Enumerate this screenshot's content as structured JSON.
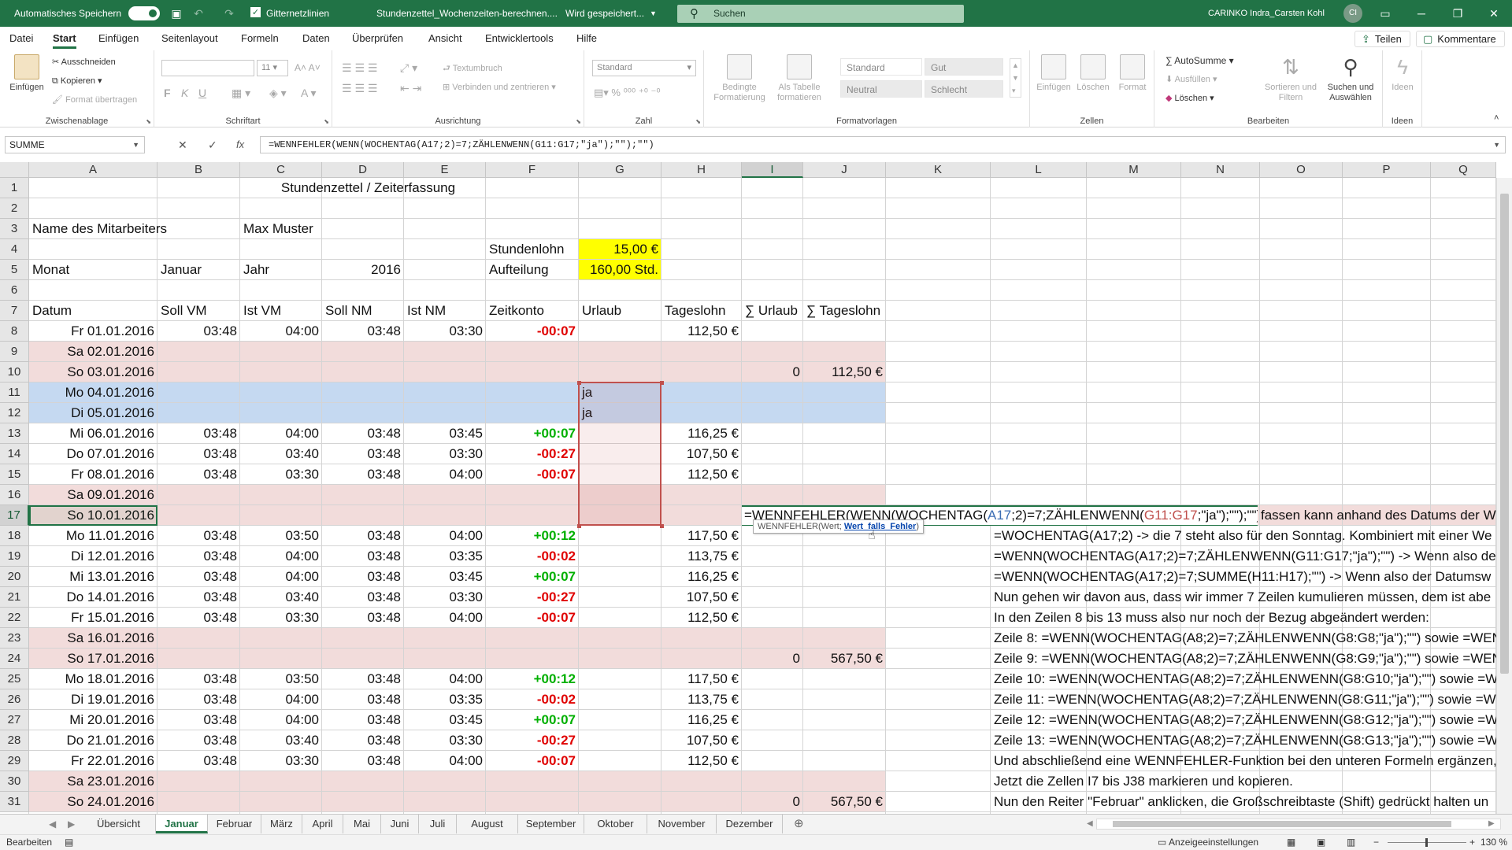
{
  "titlebar": {
    "autosave_label": "Automatisches Speichern",
    "gridlines_label": "Gitternetzlinien",
    "doc_title": "Stundenzettel_Wochenzeiten-berechnen....",
    "saving_status": "Wird gespeichert...",
    "search_placeholder": "Suchen",
    "user_name": "CARINKO Indra_Carsten Kohl",
    "user_initials": "CI"
  },
  "ribbon_tabs": [
    "Datei",
    "Start",
    "Einfügen",
    "Seitenlayout",
    "Formeln",
    "Daten",
    "Überprüfen",
    "Ansicht",
    "Entwicklertools",
    "Hilfe"
  ],
  "header_buttons": {
    "share": "Teilen",
    "comments": "Kommentare"
  },
  "ribbon": {
    "clipboard": {
      "paste": "Einfügen",
      "cut": "Ausschneiden",
      "copy": "Kopieren",
      "format_painter": "Format übertragen",
      "label": "Zwischenablage"
    },
    "font": {
      "label": "Schriftart",
      "size": "11",
      "bold": "F",
      "italic": "K",
      "underline": "U"
    },
    "alignment": {
      "wrap": "Textumbruch",
      "merge": "Verbinden und zentrieren",
      "label": "Ausrichtung"
    },
    "number": {
      "format": "Standard",
      "label": "Zahl"
    },
    "styles": {
      "cond_format": "Bedingte Formatierung",
      "as_table": "Als Tabelle formatieren",
      "standard": "Standard",
      "gut": "Gut",
      "neutral": "Neutral",
      "schlecht": "Schlecht",
      "label": "Formatvorlagen"
    },
    "cells": {
      "insert": "Einfügen",
      "delete": "Löschen",
      "format": "Format",
      "label": "Zellen"
    },
    "editing": {
      "autosum": "AutoSumme",
      "fill": "Ausfüllen",
      "clear": "Löschen",
      "sort": "Sortieren und Filtern",
      "find": "Suchen und Auswählen",
      "label": "Bearbeiten"
    },
    "ideas": {
      "ideas": "Ideen",
      "label": "Ideen"
    }
  },
  "formula_bar": {
    "name_box": "SUMME",
    "formula": "=WENNFEHLER(WENN(WOCHENTAG(A17;2)=7;ZÄHLENWENN(G11:G17;\"ja\");\"\");\"\")"
  },
  "columns": [
    "A",
    "B",
    "C",
    "D",
    "E",
    "F",
    "G",
    "H",
    "I",
    "J",
    "K",
    "L",
    "M",
    "N",
    "O",
    "P",
    "Q"
  ],
  "rows": [
    "1",
    "2",
    "3",
    "4",
    "5",
    "6",
    "7",
    "8",
    "9",
    "10",
    "11",
    "12",
    "13",
    "14",
    "15",
    "16",
    "17",
    "18",
    "19",
    "20",
    "21",
    "22",
    "23",
    "24",
    "25",
    "26",
    "27",
    "28",
    "29",
    "30",
    "31"
  ],
  "sheet": {
    "title": "Stundenzettel / Zeiterfassung",
    "employee_label": "Name des Mitarbeiters",
    "employee_name": "Max Muster",
    "wage_label": "Stundenlohn",
    "wage_value": "15,00 €",
    "month_label": "Monat",
    "month_value": "Januar",
    "year_label": "Jahr",
    "year_value": "2016",
    "split_label": "Aufteilung",
    "split_value": "160,00 Std.",
    "headers": {
      "datum": "Datum",
      "soll_vm": "Soll VM",
      "ist_vm": "Ist VM",
      "soll_nm": "Soll NM",
      "ist_nm": "Ist NM",
      "zeitkonto": "Zeitkonto",
      "urlaub": "Urlaub",
      "tageslohn": "Tageslohn",
      "sum_urlaub": "∑ Urlaub",
      "sum_tageslohn": "∑ Tageslohn"
    },
    "days": [
      {
        "datum": "Fr 01.01.2016",
        "soll_vm": "03:48",
        "ist_vm": "04:00",
        "soll_nm": "03:48",
        "ist_nm": "03:30",
        "zeitkonto": "-00:07",
        "urlaub": "",
        "tageslohn": "112,50 €",
        "sum_urlaub": "",
        "sum_tageslohn": ""
      },
      {
        "datum": "Sa 02.01.2016",
        "soll_vm": "",
        "ist_vm": "",
        "soll_nm": "",
        "ist_nm": "",
        "zeitkonto": "",
        "urlaub": "",
        "tageslohn": "",
        "sum_urlaub": "",
        "sum_tageslohn": ""
      },
      {
        "datum": "So 03.01.2016",
        "soll_vm": "",
        "ist_vm": "",
        "soll_nm": "",
        "ist_nm": "",
        "zeitkonto": "",
        "urlaub": "",
        "tageslohn": "",
        "sum_urlaub": "0",
        "sum_tageslohn": "112,50 €"
      },
      {
        "datum": "Mo 04.01.2016",
        "soll_vm": "",
        "ist_vm": "",
        "soll_nm": "",
        "ist_nm": "",
        "zeitkonto": "",
        "urlaub": "ja",
        "tageslohn": "",
        "sum_urlaub": "",
        "sum_tageslohn": ""
      },
      {
        "datum": "Di 05.01.2016",
        "soll_vm": "",
        "ist_vm": "",
        "soll_nm": "",
        "ist_nm": "",
        "zeitkonto": "",
        "urlaub": "ja",
        "tageslohn": "",
        "sum_urlaub": "",
        "sum_tageslohn": ""
      },
      {
        "datum": "Mi 06.01.2016",
        "soll_vm": "03:48",
        "ist_vm": "04:00",
        "soll_nm": "03:48",
        "ist_nm": "03:45",
        "zeitkonto": "+00:07",
        "urlaub": "",
        "tageslohn": "116,25 €",
        "sum_urlaub": "",
        "sum_tageslohn": ""
      },
      {
        "datum": "Do 07.01.2016",
        "soll_vm": "03:48",
        "ist_vm": "03:40",
        "soll_nm": "03:48",
        "ist_nm": "03:30",
        "zeitkonto": "-00:27",
        "urlaub": "",
        "tageslohn": "107,50 €",
        "sum_urlaub": "",
        "sum_tageslohn": ""
      },
      {
        "datum": "Fr 08.01.2016",
        "soll_vm": "03:48",
        "ist_vm": "03:30",
        "soll_nm": "03:48",
        "ist_nm": "04:00",
        "zeitkonto": "-00:07",
        "urlaub": "",
        "tageslohn": "112,50 €",
        "sum_urlaub": "",
        "sum_tageslohn": ""
      },
      {
        "datum": "Sa 09.01.2016",
        "soll_vm": "",
        "ist_vm": "",
        "soll_nm": "",
        "ist_nm": "",
        "zeitkonto": "",
        "urlaub": "",
        "tageslohn": "",
        "sum_urlaub": "",
        "sum_tageslohn": ""
      },
      {
        "datum": "So 10.01.2016",
        "soll_vm": "",
        "ist_vm": "",
        "soll_nm": "",
        "ist_nm": "",
        "zeitkonto": "",
        "urlaub": "",
        "tageslohn": "",
        "sum_urlaub": "",
        "sum_tageslohn": ""
      },
      {
        "datum": "Mo 11.01.2016",
        "soll_vm": "03:48",
        "ist_vm": "03:50",
        "soll_nm": "03:48",
        "ist_nm": "04:00",
        "zeitkonto": "+00:12",
        "urlaub": "",
        "tageslohn": "117,50 €",
        "sum_urlaub": "",
        "sum_tageslohn": ""
      },
      {
        "datum": "Di 12.01.2016",
        "soll_vm": "03:48",
        "ist_vm": "04:00",
        "soll_nm": "03:48",
        "ist_nm": "03:35",
        "zeitkonto": "-00:02",
        "urlaub": "",
        "tageslohn": "113,75 €",
        "sum_urlaub": "",
        "sum_tageslohn": ""
      },
      {
        "datum": "Mi 13.01.2016",
        "soll_vm": "03:48",
        "ist_vm": "04:00",
        "soll_nm": "03:48",
        "ist_nm": "03:45",
        "zeitkonto": "+00:07",
        "urlaub": "",
        "tageslohn": "116,25 €",
        "sum_urlaub": "",
        "sum_tageslohn": ""
      },
      {
        "datum": "Do 14.01.2016",
        "soll_vm": "03:48",
        "ist_vm": "03:40",
        "soll_nm": "03:48",
        "ist_nm": "03:30",
        "zeitkonto": "-00:27",
        "urlaub": "",
        "tageslohn": "107,50 €",
        "sum_urlaub": "",
        "sum_tageslohn": ""
      },
      {
        "datum": "Fr 15.01.2016",
        "soll_vm": "03:48",
        "ist_vm": "03:30",
        "soll_nm": "03:48",
        "ist_nm": "04:00",
        "zeitkonto": "-00:07",
        "urlaub": "",
        "tageslohn": "112,50 €",
        "sum_urlaub": "",
        "sum_tageslohn": ""
      },
      {
        "datum": "Sa 16.01.2016",
        "soll_vm": "",
        "ist_vm": "",
        "soll_nm": "",
        "ist_nm": "",
        "zeitkonto": "",
        "urlaub": "",
        "tageslohn": "",
        "sum_urlaub": "",
        "sum_tageslohn": ""
      },
      {
        "datum": "So 17.01.2016",
        "soll_vm": "",
        "ist_vm": "",
        "soll_nm": "",
        "ist_nm": "",
        "zeitkonto": "",
        "urlaub": "",
        "tageslohn": "",
        "sum_urlaub": "0",
        "sum_tageslohn": "567,50 €"
      },
      {
        "datum": "Mo 18.01.2016",
        "soll_vm": "03:48",
        "ist_vm": "03:50",
        "soll_nm": "03:48",
        "ist_nm": "04:00",
        "zeitkonto": "+00:12",
        "urlaub": "",
        "tageslohn": "117,50 €",
        "sum_urlaub": "",
        "sum_tageslohn": ""
      },
      {
        "datum": "Di 19.01.2016",
        "soll_vm": "03:48",
        "ist_vm": "04:00",
        "soll_nm": "03:48",
        "ist_nm": "03:35",
        "zeitkonto": "-00:02",
        "urlaub": "",
        "tageslohn": "113,75 €",
        "sum_urlaub": "",
        "sum_tageslohn": ""
      },
      {
        "datum": "Mi 20.01.2016",
        "soll_vm": "03:48",
        "ist_vm": "04:00",
        "soll_nm": "03:48",
        "ist_nm": "03:45",
        "zeitkonto": "+00:07",
        "urlaub": "",
        "tageslohn": "116,25 €",
        "sum_urlaub": "",
        "sum_tageslohn": ""
      },
      {
        "datum": "Do 21.01.2016",
        "soll_vm": "03:48",
        "ist_vm": "03:40",
        "soll_nm": "03:48",
        "ist_nm": "03:30",
        "zeitkonto": "-00:27",
        "urlaub": "",
        "tageslohn": "107,50 €",
        "sum_urlaub": "",
        "sum_tageslohn": ""
      },
      {
        "datum": "Fr 22.01.2016",
        "soll_vm": "03:48",
        "ist_vm": "03:30",
        "soll_nm": "03:48",
        "ist_nm": "04:00",
        "zeitkonto": "-00:07",
        "urlaub": "",
        "tageslohn": "112,50 €",
        "sum_urlaub": "",
        "sum_tageslohn": ""
      },
      {
        "datum": "Sa 23.01.2016",
        "soll_vm": "",
        "ist_vm": "",
        "soll_nm": "",
        "ist_nm": "",
        "zeitkonto": "",
        "urlaub": "",
        "tageslohn": "",
        "sum_urlaub": "",
        "sum_tageslohn": ""
      },
      {
        "datum": "So 24.01.2016",
        "soll_vm": "",
        "ist_vm": "",
        "soll_nm": "",
        "ist_nm": "",
        "zeitkonto": "",
        "urlaub": "",
        "tageslohn": "",
        "sum_urlaub": "0",
        "sum_tageslohn": "567,50 €"
      }
    ],
    "editing_formula": {
      "p1": "=WENNFEHLER(WENN(WOCHENTAG(",
      "r1": "A17",
      "p2": ";2)=7;ZÄHLENWENN(",
      "r2": "G11:G17",
      "p3": ";\"ja\");\"\");\"\")"
    },
    "tooltip": {
      "fn": "WENNFEHLER(Wert; ",
      "arg": "Wert_falls_Fehler",
      ")": ")"
    },
    "notes": [
      {
        "row": 17,
        "text": "fassen kann anhand des Datums der W"
      },
      {
        "row": 18,
        "text": "=WOCHENTAG(A17;2)  -> die 7 steht also für den Sonntag. Kombiniert mit einer We"
      },
      {
        "row": 19,
        "text": "=WENN(WOCHENTAG(A17;2)=7;ZÄHLENWENN(G11:G17;\"ja\");\"\")  -> Wenn also de"
      },
      {
        "row": 20,
        "text": "=WENN(WOCHENTAG(A17;2)=7;SUMME(H11:H17);\"\")  -> Wenn also der Datumsw"
      },
      {
        "row": 21,
        "text": "Nun gehen wir davon aus, dass wir immer 7 Zeilen kumulieren müssen, dem ist abe"
      },
      {
        "row": 22,
        "text": "In den Zeilen 8 bis 13 muss also nur noch der Bezug abgeändert werden:"
      },
      {
        "row": 23,
        "text": "Zeile 8: =WENN(WOCHENTAG(A8;2)=7;ZÄHLENWENN(G8:G8;\"ja\");\"\") sowie =WEN"
      },
      {
        "row": 24,
        "text": "Zeile 9: =WENN(WOCHENTAG(A8;2)=7;ZÄHLENWENN(G8:G9;\"ja\");\"\") sowie =WEN"
      },
      {
        "row": 25,
        "text": "Zeile 10: =WENN(WOCHENTAG(A8;2)=7;ZÄHLENWENN(G8:G10;\"ja\");\"\") sowie =WE"
      },
      {
        "row": 26,
        "text": "Zeile 11: =WENN(WOCHENTAG(A8;2)=7;ZÄHLENWENN(G8:G11;\"ja\");\"\") sowie =WE"
      },
      {
        "row": 27,
        "text": "Zeile 12: =WENN(WOCHENTAG(A8;2)=7;ZÄHLENWENN(G8:G12;\"ja\");\"\") sowie =WE"
      },
      {
        "row": 28,
        "text": "Zeile 13: =WENN(WOCHENTAG(A8;2)=7;ZÄHLENWENN(G8:G13;\"ja\");\"\") sowie =WE"
      },
      {
        "row": 29,
        "text": "Und abschließend eine WENNFEHLER-Funktion bei den unteren Formeln ergänzen, "
      },
      {
        "row": 30,
        "text": "Jetzt die Zellen I7 bis J38 markieren und kopieren."
      },
      {
        "row": 31,
        "text": "Nun den Reiter \"Februar\" anklicken, die Großschreibtaste (Shift) gedrückt halten un"
      }
    ]
  },
  "sheet_tabs": [
    "Übersicht",
    "Januar",
    "Februar",
    "März",
    "April",
    "Mai",
    "Juni",
    "Juli",
    "August",
    "September",
    "Oktober",
    "November",
    "Dezember"
  ],
  "active_sheet": "Januar",
  "status": {
    "mode": "Bearbeiten",
    "display_settings": "Anzeigeeinstellungen",
    "zoom": "130 %"
  },
  "colors": {
    "excel_green": "#217346",
    "weekend_pink": "#f2dcdb",
    "vacation_blue": "#c5d9f1",
    "yellow": "#ffff00",
    "negative_red": "#e00000",
    "positive_green": "#00b000"
  }
}
